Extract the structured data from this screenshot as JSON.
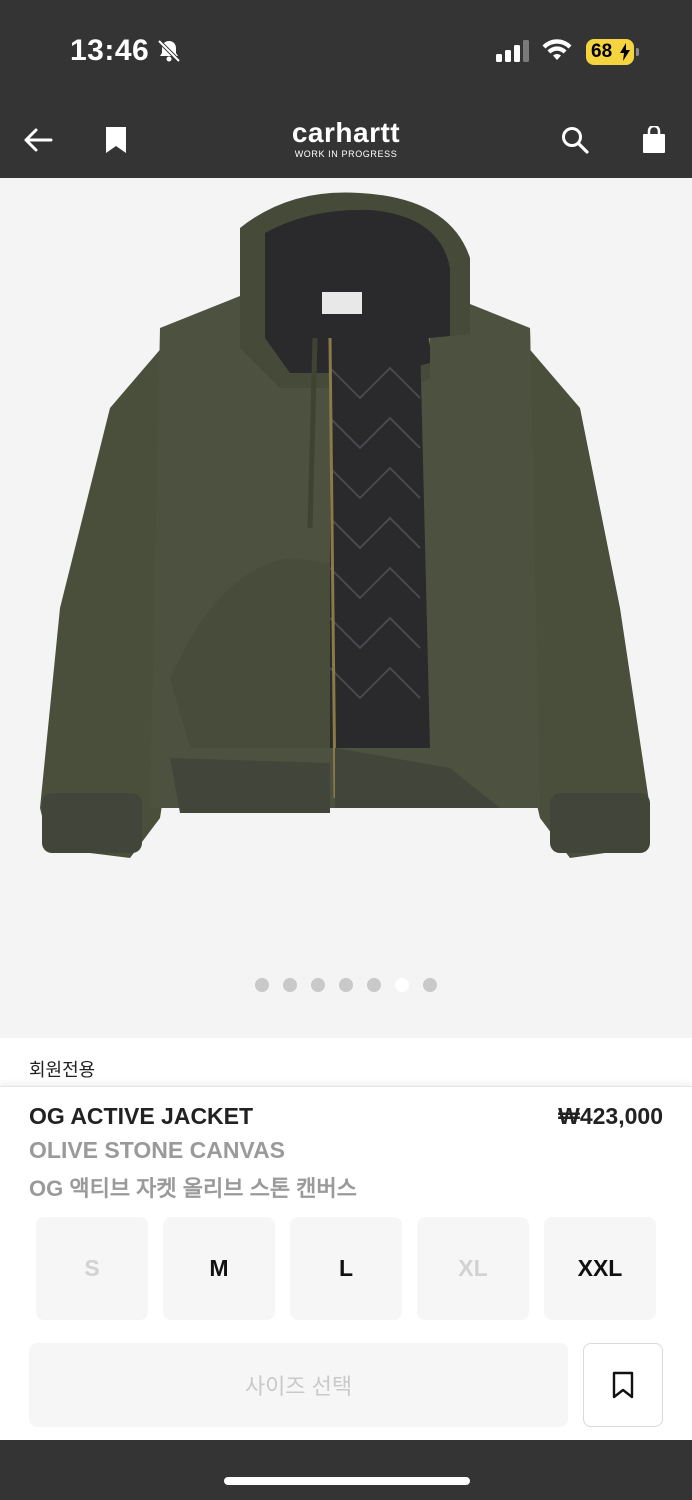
{
  "status_bar": {
    "time": "13:46",
    "battery": "68",
    "icons": [
      "bell-slash-icon",
      "signal-icon",
      "wifi-icon",
      "battery-icon"
    ]
  },
  "nav": {
    "logo_main": "carhartt",
    "logo_sub": "WORK IN PROGRESS",
    "icons": [
      "back-arrow-icon",
      "bookmark-icon",
      "search-icon",
      "shopping-bag-icon"
    ]
  },
  "gallery": {
    "image_count": 7,
    "active_index": 5,
    "image_colors": {
      "jacket": "#4a4f3c",
      "lining": "#2a2a2c"
    }
  },
  "members_only": "회원전용",
  "product": {
    "name": "OG ACTIVE JACKET",
    "price": "₩423,000",
    "color": "OLIVE STONE CANVAS",
    "korean_name": "OG 액티브 자켓 올리브 스톤 캔버스"
  },
  "sizes": [
    {
      "label": "S",
      "available": false
    },
    {
      "label": "M",
      "available": true
    },
    {
      "label": "L",
      "available": true
    },
    {
      "label": "XL",
      "available": false
    },
    {
      "label": "XXL",
      "available": true
    }
  ],
  "actions": {
    "select_size": "사이즈 선택"
  },
  "colors": {
    "bar": "#343434",
    "battery": "#f5d43f",
    "text_dark": "#222222",
    "text_muted": "#9a9a9a"
  }
}
